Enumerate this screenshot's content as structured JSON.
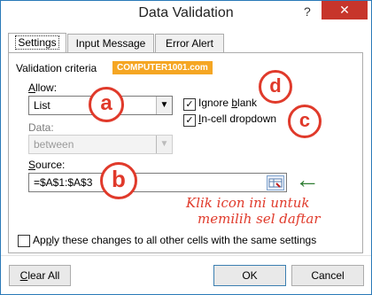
{
  "dialog": {
    "title": "Data Validation",
    "help_glyph": "?",
    "close_glyph": "✕"
  },
  "tabs": [
    {
      "label": "Settings",
      "active": true
    },
    {
      "label": "Input Message",
      "active": false
    },
    {
      "label": "Error Alert",
      "active": false
    }
  ],
  "settings": {
    "section_label": "Validation criteria",
    "allow_label_hotkey": "A",
    "allow_label_rest": "llow:",
    "allow_value": "List",
    "data_label": "Data:",
    "data_value": "between",
    "ignore_blank_hotkey": "Ignore ",
    "ignore_blank_rest_u": "b",
    "ignore_blank_rest": "lank",
    "ignore_blank_checked": true,
    "incell_hotkey": "I",
    "incell_rest": "n-cell dropdown",
    "incell_checked": true,
    "source_label_hotkey": "S",
    "source_label_rest": "ource:",
    "source_value": "=$A$1:$A$3",
    "apply_prefix": "Ap",
    "apply_hotkey": "p",
    "apply_rest": "ly these changes to all other cells with the same settings",
    "apply_checked": false
  },
  "annotations": {
    "watermark": "COMPUTER1001.com",
    "marker_a": "a",
    "marker_b": "b",
    "marker_c": "c",
    "marker_d": "d",
    "arrow_glyph": "←",
    "note_line1": "Klik icon ini untuk",
    "note_line2": "memilih sel daftar",
    "accent_color": "#e03a2b",
    "arrow_color": "#2e7d32",
    "badge_color": "#f5a623"
  },
  "buttons": {
    "clear_all_hotkey": "C",
    "clear_all_rest": "lear All",
    "ok": "OK",
    "cancel": "Cancel"
  }
}
